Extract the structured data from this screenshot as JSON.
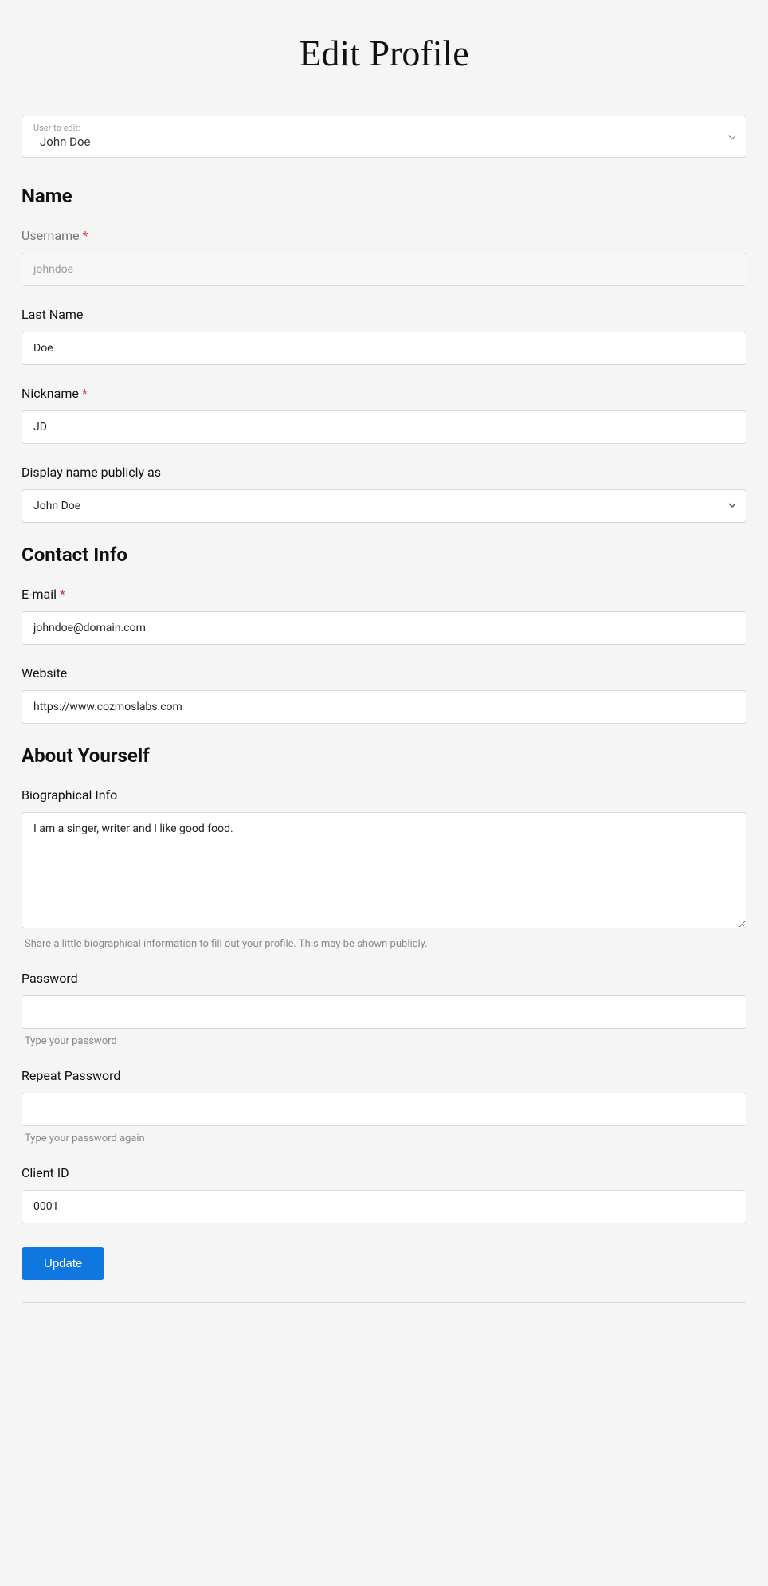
{
  "page": {
    "title": "Edit Profile"
  },
  "user_select": {
    "label": "User to edit:",
    "value": "John Doe"
  },
  "sections": {
    "name": {
      "heading": "Name",
      "username": {
        "label": "Username",
        "value": "johndoe",
        "required": true
      },
      "last_name": {
        "label": "Last Name",
        "value": "Doe"
      },
      "nickname": {
        "label": "Nickname",
        "value": "JD",
        "required": true
      },
      "display_name": {
        "label": "Display name publicly as",
        "value": "John Doe"
      }
    },
    "contact": {
      "heading": "Contact Info",
      "email": {
        "label": "E-mail",
        "value": "johndoe@domain.com",
        "required": true
      },
      "website": {
        "label": "Website",
        "value": "https://www.cozmoslabs.com"
      }
    },
    "about": {
      "heading": "About Yourself",
      "bio": {
        "label": "Biographical Info",
        "value": "I am a singer, writer and I like good food.",
        "help": "Share a little biographical information to fill out your profile. This may be shown publicly."
      },
      "password": {
        "label": "Password",
        "value": "",
        "help": "Type your password"
      },
      "repeat_password": {
        "label": "Repeat Password",
        "value": "",
        "help": "Type your password again"
      },
      "client_id": {
        "label": "Client ID",
        "value": "0001"
      }
    }
  },
  "actions": {
    "submit": "Update"
  }
}
